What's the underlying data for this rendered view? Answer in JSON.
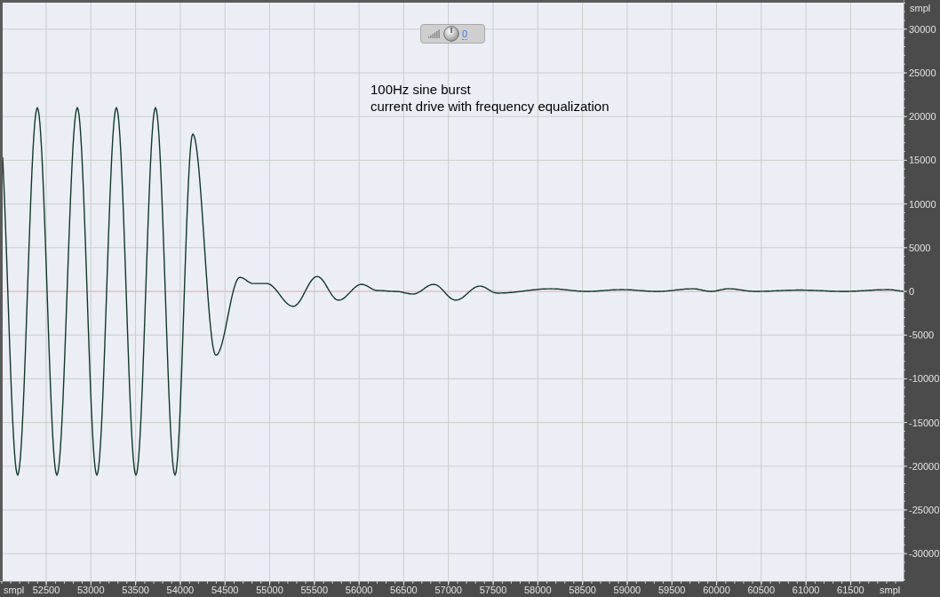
{
  "caption": [
    "100Hz sine burst",
    "current drive with frequency equalization"
  ],
  "volume_control": {
    "value": "0"
  },
  "vertical_ruler": {
    "unit": "smpl",
    "labels": [
      "30000",
      "25000",
      "20000",
      "15000",
      "10000",
      "5000",
      "0",
      "-5000",
      "-10000",
      "-15000",
      "-20000",
      "-25000",
      "-30000"
    ]
  },
  "horizontal_ruler": {
    "unit_left": "smpl",
    "unit_right": "smpl",
    "labels": [
      "52500",
      "53000",
      "53500",
      "54000",
      "54500",
      "55000",
      "55500",
      "56000",
      "56500",
      "57000",
      "57500",
      "58000",
      "58500",
      "59000",
      "59500",
      "60000",
      "60500",
      "61000",
      "61500"
    ]
  }
}
